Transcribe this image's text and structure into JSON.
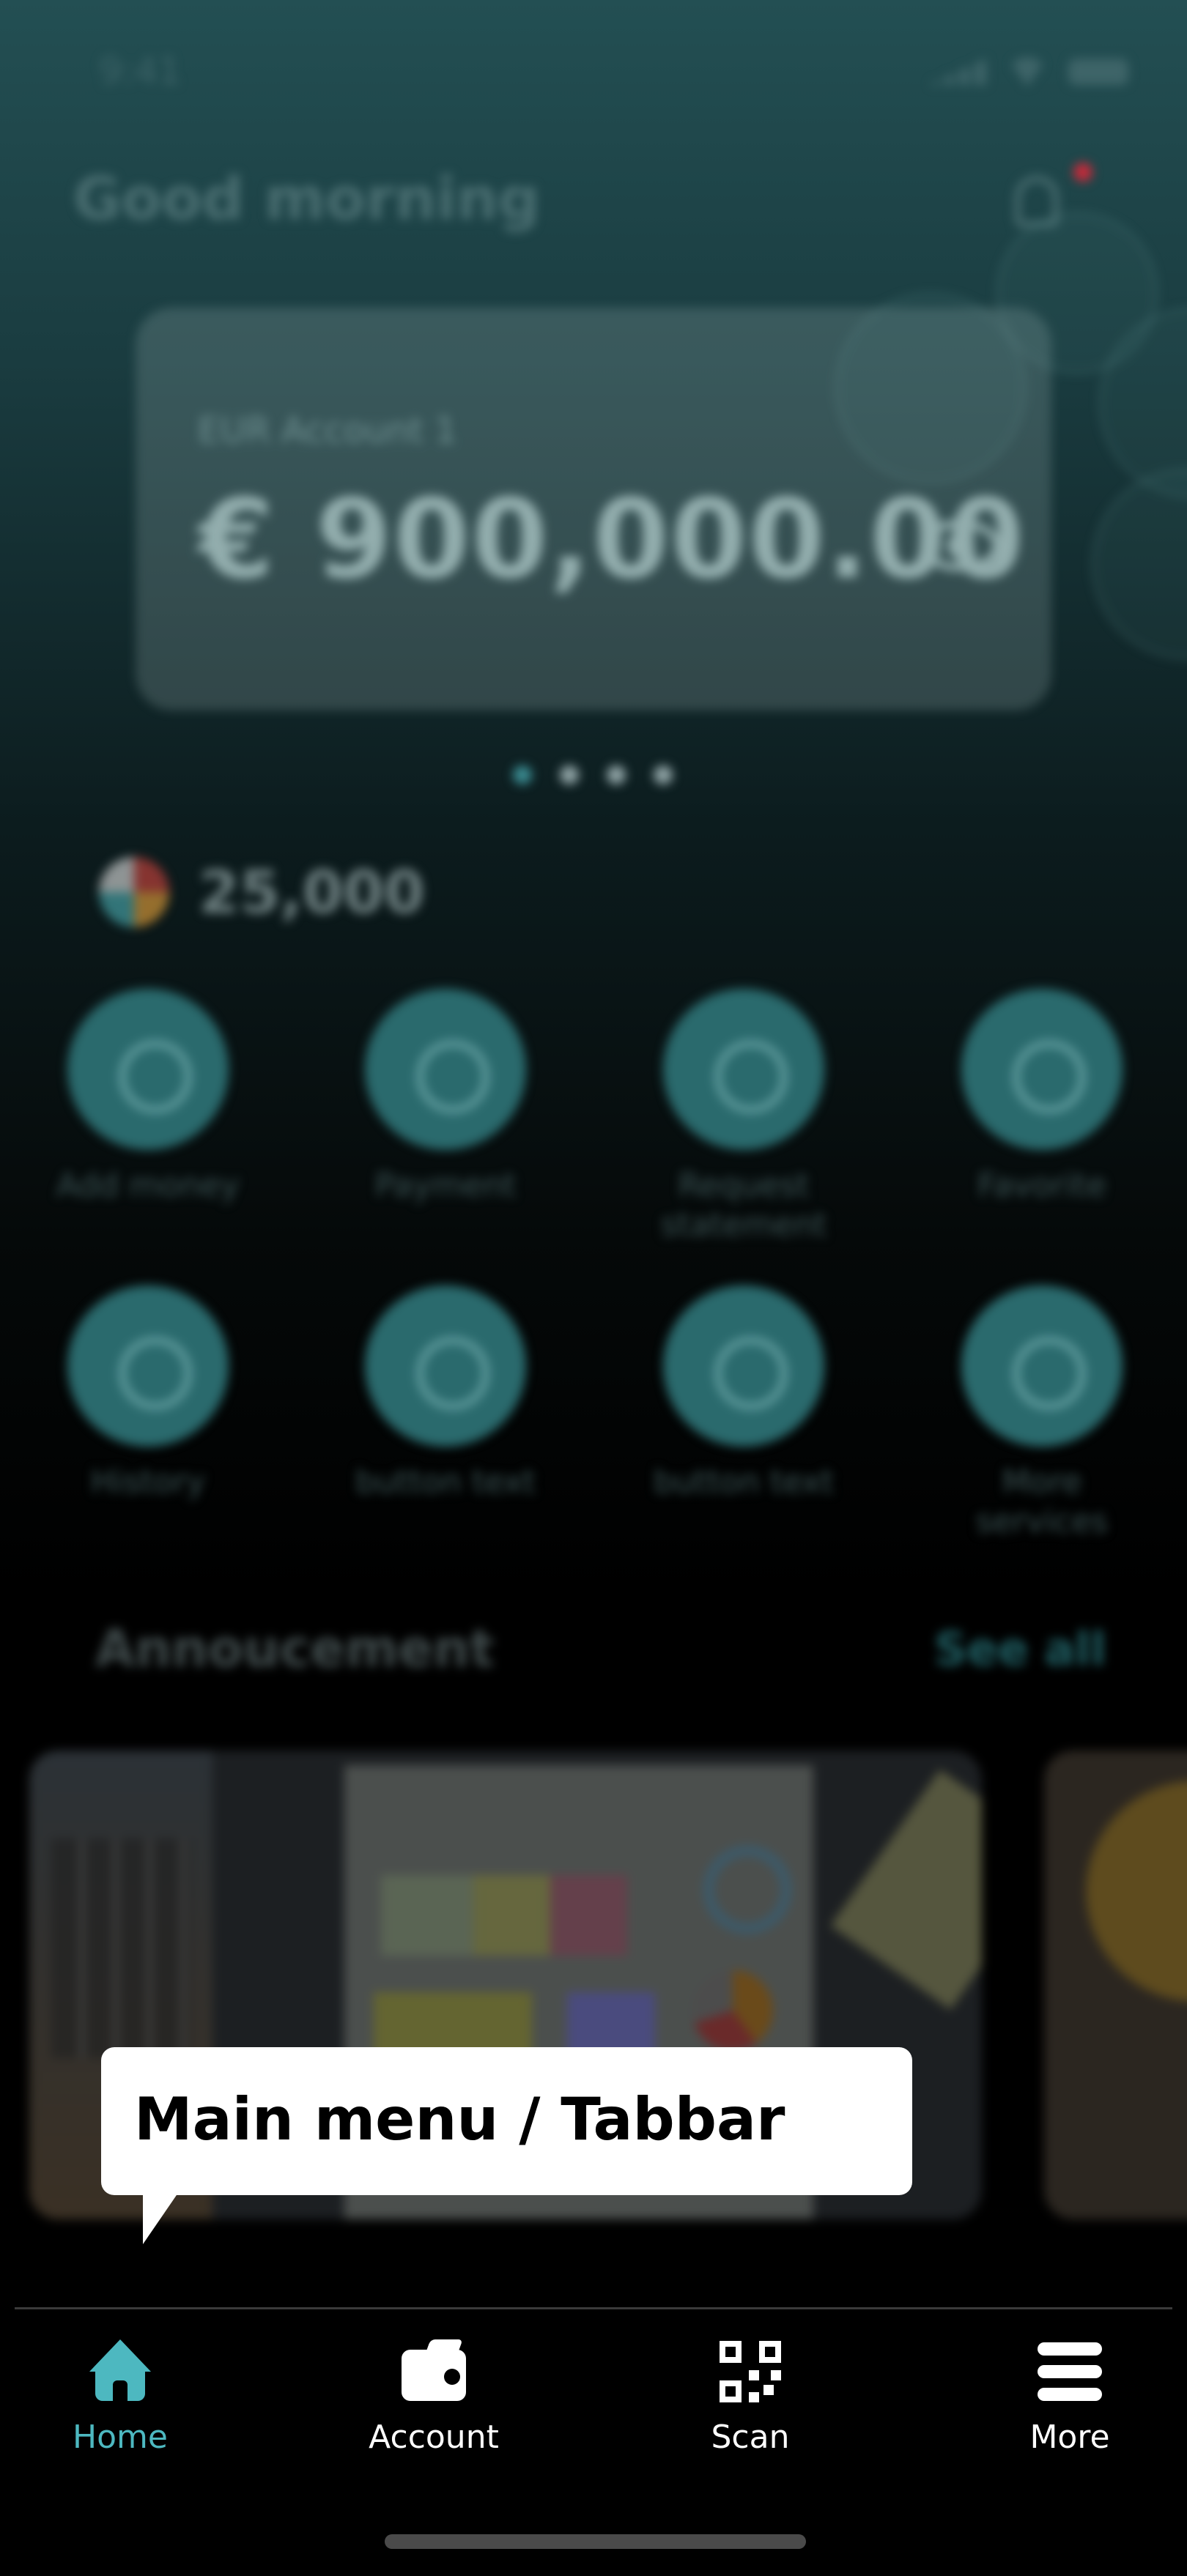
{
  "status_bar": {
    "time": "9:41"
  },
  "header": {
    "greeting": "Good morning"
  },
  "account_card": {
    "label": "EUR Account 1",
    "balance": "€ 900,000.00",
    "carousel_pages": 4,
    "active_page": 1
  },
  "points": {
    "value": "25,000"
  },
  "services": [
    {
      "label": "Add money",
      "icon": "plus-circle-icon"
    },
    {
      "label": "Payment",
      "icon": "payment-icon"
    },
    {
      "label": "Request statement",
      "icon": "document-icon"
    },
    {
      "label": "Favorite",
      "icon": "heart-icon"
    },
    {
      "label": "History",
      "icon": "clock-icon"
    },
    {
      "label": "button text",
      "icon": "plus-circle-icon"
    },
    {
      "label": "button text",
      "icon": "plus-circle-icon"
    },
    {
      "label": "More services",
      "icon": "grid-icon"
    }
  ],
  "announcement": {
    "title": "Annoucement",
    "see_all": "See all"
  },
  "tooltip": {
    "text": "Main menu / Tabbar"
  },
  "tabbar": {
    "tabs": [
      {
        "label": "Home",
        "icon": "home-icon",
        "active": true
      },
      {
        "label": "Account",
        "icon": "wallet-icon",
        "active": false
      },
      {
        "label": "Scan",
        "icon": "qr-code-icon",
        "active": false
      },
      {
        "label": "More",
        "icon": "menu-icon",
        "active": false
      }
    ]
  },
  "colors": {
    "accent": "#4db8c0",
    "tooltip_bg": "#ffffff",
    "tabbar_bg": "#000000",
    "notification_dot": "#c62a3a"
  }
}
